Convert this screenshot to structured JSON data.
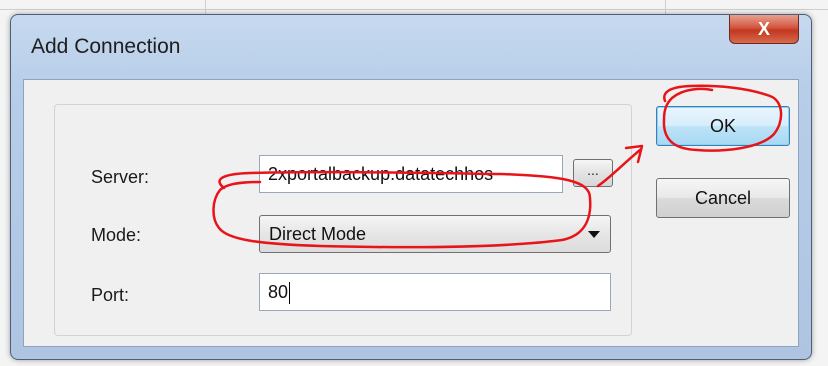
{
  "dialog": {
    "title": "Add Connection",
    "close_label": "X"
  },
  "form": {
    "server_label": "Server:",
    "server_value": "2xportalbackup.datatechhos",
    "browse_label": "...",
    "mode_label": "Mode:",
    "mode_value": "Direct Mode",
    "port_label": "Port:",
    "port_value": "80"
  },
  "buttons": {
    "ok_label": "OK",
    "cancel_label": "Cancel"
  },
  "colors": {
    "annotation": "#e8141a"
  }
}
